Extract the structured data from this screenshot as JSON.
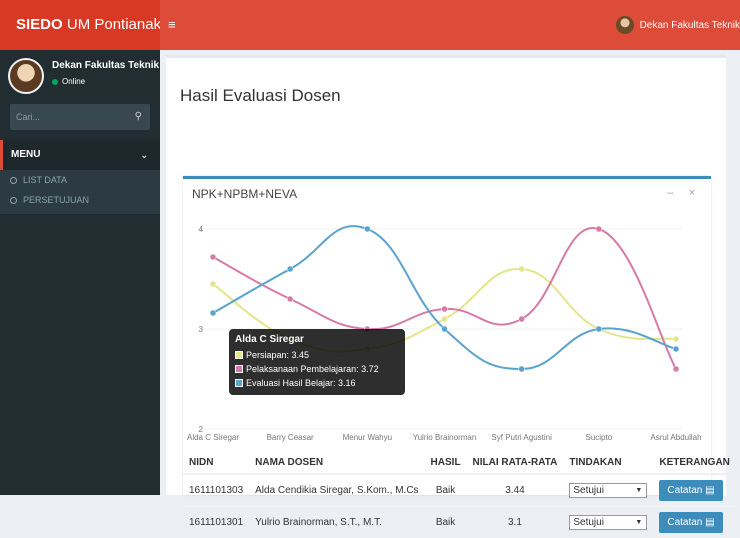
{
  "app": {
    "brand_bold": "SIEDO",
    "brand_rest": " UM Pontianak"
  },
  "navbar": {
    "menu_icon": "≡",
    "user_name": "Dekan Fakultas Teknik"
  },
  "sidebar": {
    "user_name": "Dekan Fakultas Teknik",
    "status": "Online",
    "search_placeholder": "Cari...",
    "menu_header": "MENU",
    "items": [
      {
        "label": "LIST DATA"
      },
      {
        "label": "PERSETUJUAN"
      }
    ]
  },
  "page": {
    "title": "Hasil Evaluasi Dosen"
  },
  "box": {
    "title": "NPK+NPBM+NEVA",
    "tools": "– ×"
  },
  "chart_data": {
    "type": "line",
    "categories": [
      "Alda C Siregar",
      "Barry Ceasar",
      "Menur Wahyu",
      "Yulrio Brainorman",
      "Syf Putri Agustini",
      "Sucipto",
      "Asrul Abdullah"
    ],
    "ylim": [
      2,
      4
    ],
    "yticks": [
      "2",
      "3",
      "4"
    ],
    "series": [
      {
        "name": "Persiapan",
        "color": "#e3e68a",
        "values": [
          3.45,
          2.9,
          2.8,
          3.1,
          3.6,
          3.0,
          2.9
        ]
      },
      {
        "name": "Pelaksanaan Pembelajaran",
        "color": "#d77aa8",
        "values": [
          3.72,
          3.3,
          3.0,
          3.2,
          3.1,
          4.0,
          2.6
        ]
      },
      {
        "name": "Evaluasi Hasil Belajar",
        "color": "#5aa3cf",
        "values": [
          3.16,
          3.6,
          4.0,
          3.0,
          2.6,
          3.0,
          2.8
        ]
      }
    ],
    "tooltip": {
      "title": "Alda C Siregar",
      "rows": [
        {
          "label": "Persiapan: 3.45",
          "color": "#e3e68a"
        },
        {
          "label": "Pelaksanaan Pembelajaran: 3.72",
          "color": "#d77aa8"
        },
        {
          "label": "Evaluasi Hasil Belajar: 3.16",
          "color": "#5aa3cf"
        }
      ]
    }
  },
  "table": {
    "headers": [
      "NIDN",
      "NAMA DOSEN",
      "HASIL",
      "NILAI RATA-RATA",
      "TINDAKAN",
      "KETERANGAN"
    ],
    "rows": [
      {
        "nidn": "1611101303",
        "nama": "Alda Cendikia Siregar, S.Kom., M.Cs",
        "hasil": "Baik",
        "nilai": "3.44",
        "tindakan": "Setujui",
        "keterangan": "Catatan"
      },
      {
        "nidn": "1611101301",
        "nama": "Yulrio Brainorman, S.T., M.T.",
        "hasil": "Baik",
        "nilai": "3.1",
        "tindakan": "Setujui",
        "keterangan": "Catatan"
      }
    ]
  }
}
